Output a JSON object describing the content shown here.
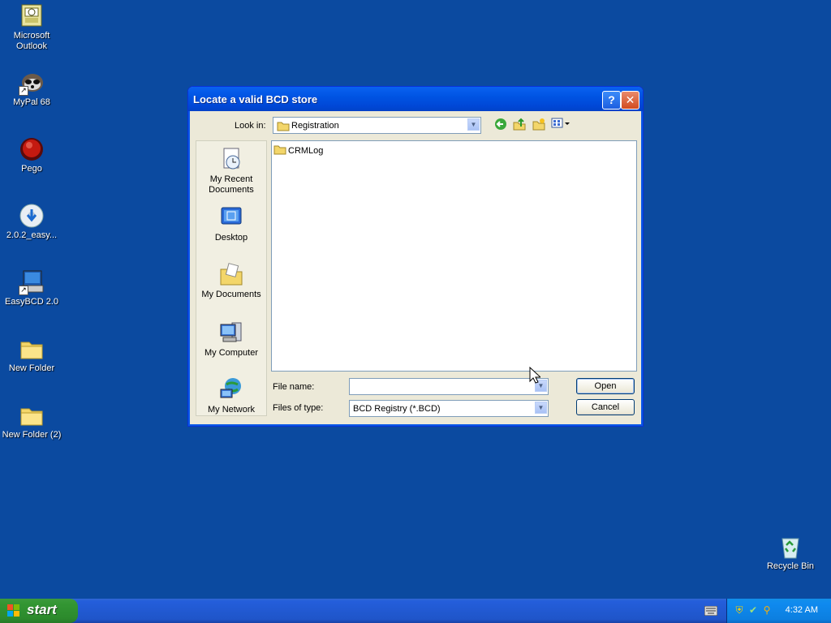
{
  "desktop": {
    "icons": [
      {
        "label": "Microsoft Outlook",
        "icon": "outlook-icon"
      },
      {
        "label": "MyPal 68",
        "icon": "mypal-icon"
      },
      {
        "label": "Pego",
        "icon": "pego-icon"
      },
      {
        "label": "2.0.2_easy...",
        "icon": "installer-icon"
      },
      {
        "label": "EasyBCD 2.0",
        "icon": "easybcd-icon"
      },
      {
        "label": "New Folder",
        "icon": "folder-icon"
      },
      {
        "label": "New Folder (2)",
        "icon": "folder-icon"
      },
      {
        "label": "Recycle Bin",
        "icon": "recycle-bin-icon"
      }
    ]
  },
  "dialog": {
    "title": "Locate a valid BCD store",
    "help_glyph": "?",
    "close_glyph": "✕",
    "look_in_label": "Look in:",
    "look_in_value": "Registration",
    "places": [
      {
        "label": "My Recent Documents"
      },
      {
        "label": "Desktop"
      },
      {
        "label": "My Documents"
      },
      {
        "label": "My Computer"
      },
      {
        "label": "My Network"
      }
    ],
    "files": [
      {
        "name": "CRMLog",
        "type": "folder"
      }
    ],
    "file_name_label": "File name:",
    "file_name_value": "",
    "files_of_type_label": "Files of type:",
    "files_of_type_value": "BCD Registry (*.BCD)",
    "open_label": "Open",
    "cancel_label": "Cancel"
  },
  "taskbar": {
    "start_label": "start",
    "clock": "4:32 AM"
  },
  "colors": {
    "desktop": "#0b4aa0",
    "titlebar": "#0054e3",
    "start_green": "#339633"
  }
}
